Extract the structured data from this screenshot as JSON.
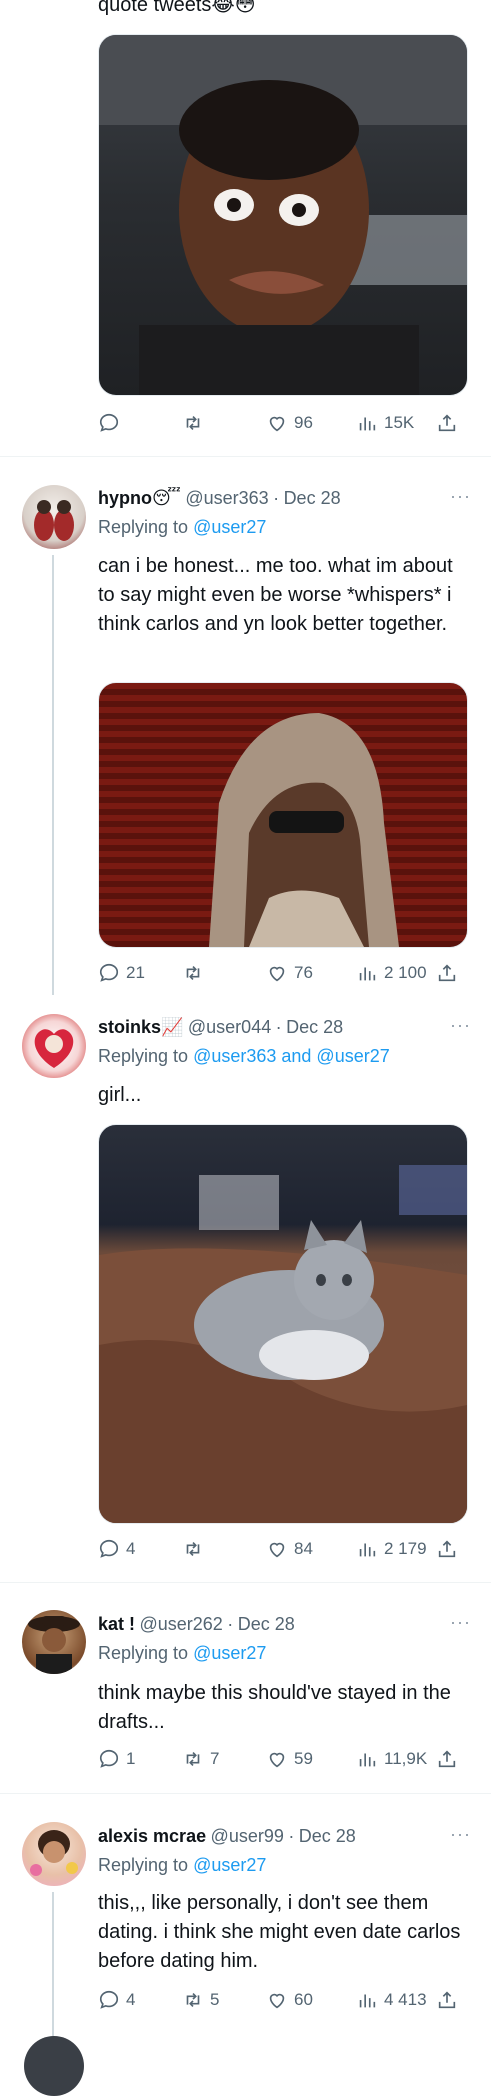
{
  "top_tweet": {
    "text_tail": "quote tweets😂😳",
    "actions": {
      "replies": "",
      "retweets": "",
      "likes": "96",
      "views": "15K"
    }
  },
  "tweets": [
    {
      "name": "hypno😴",
      "handle": "@user363",
      "date": "Dec 28",
      "replying_prefix": "Replying to",
      "replying_to": "@user27",
      "text": "can i be honest... me too. what im about to say might even be worse *whispers* i think carlos and yn look better together.",
      "actions": {
        "replies": "21",
        "retweets": "",
        "likes": "76",
        "views": "2 100"
      }
    },
    {
      "name": "stoinks📈",
      "handle": "@user044",
      "date": "Dec 28",
      "replying_prefix": "Replying to",
      "replying_to": "@user363 and @user27",
      "text": "girl...",
      "actions": {
        "replies": "4",
        "retweets": "",
        "likes": "84",
        "views": "2 179"
      }
    },
    {
      "name": "kat !",
      "handle": "@user262",
      "date": "Dec 28",
      "replying_prefix": "Replying to",
      "replying_to": "@user27",
      "text": "think maybe this should've stayed in the drafts...",
      "actions": {
        "replies": "1",
        "retweets": "7",
        "likes": "59",
        "views": "11,9K"
      }
    },
    {
      "name": "alexis mcrae",
      "handle": "@user99",
      "date": "Dec 28",
      "replying_prefix": "Replying to",
      "replying_to": "@user27",
      "text": "this,,, like personally, i don't see them dating. i think she might even date carlos before dating him.",
      "actions": {
        "replies": "4",
        "retweets": "5",
        "likes": "60",
        "views": "4 413"
      }
    }
  ],
  "more_label": "···",
  "separator": "·",
  "icons": [
    "reply-icon",
    "retweet-icon",
    "like-icon",
    "views-icon",
    "share-icon"
  ],
  "colors": {
    "link": "#1d9bf0",
    "muted": "#536471",
    "text": "#0f1419"
  }
}
